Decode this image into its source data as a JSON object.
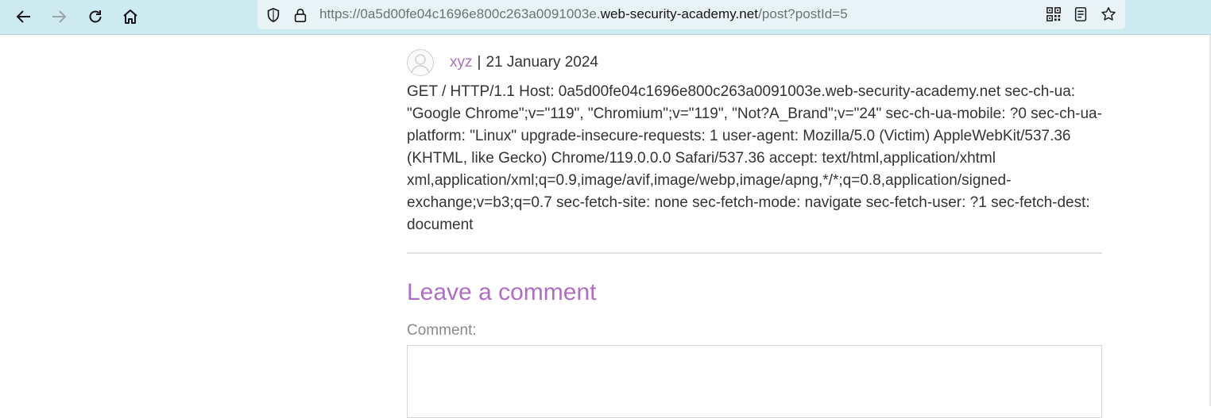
{
  "browser": {
    "url_prefix": "https://0a5d00fe04c1696e800c263a0091003e.",
    "url_domain": "web-security-academy.net",
    "url_suffix": "/post?postId=5"
  },
  "comment": {
    "author": "xyz",
    "separator": "|",
    "date": "21 January 2024",
    "body": "GET / HTTP/1.1 Host: 0a5d00fe04c1696e800c263a0091003e.web-security-academy.net sec-ch-ua: \"Google Chrome\";v=\"119\", \"Chromium\";v=\"119\", \"Not?A_Brand\";v=\"24\" sec-ch-ua-mobile: ?0 sec-ch-ua-platform: \"Linux\" upgrade-insecure-requests: 1 user-agent: Mozilla/5.0 (Victim) AppleWebKit/537.36 (KHTML, like Gecko) Chrome/119.0.0.0 Safari/537.36 accept: text/html,application/xhtml xml,application/xml;q=0.9,image/avif,image/webp,image/apng,*/*;q=0.8,application/signed-exchange;v=b3;q=0.7 sec-fetch-site: none sec-fetch-mode: navigate sec-fetch-user: ?1 sec-fetch-dest: document"
  },
  "form": {
    "title": "Leave a comment",
    "comment_label": "Comment:"
  },
  "colors": {
    "accent": "#b06dc4",
    "toolbar_bg": "#cdeaf0"
  },
  "icons": [
    "back-arrow-icon",
    "forward-arrow-icon",
    "reload-icon",
    "home-icon",
    "shield-icon",
    "lock-icon",
    "qr-code-icon",
    "reader-view-icon",
    "bookmark-star-icon",
    "avatar-icon"
  ]
}
